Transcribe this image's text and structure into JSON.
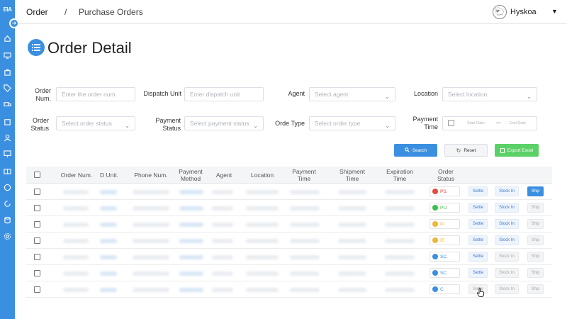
{
  "app": {
    "logo": "EIA"
  },
  "breadcrumb": {
    "section": "Order",
    "separator": "/",
    "page": "Purchase Orders"
  },
  "user": {
    "name": "Hyskoa"
  },
  "page": {
    "title": "Order Detail"
  },
  "filters": {
    "order_num": {
      "label": "Order Num.",
      "placeholder": "Enter the order num."
    },
    "dispatch_unit": {
      "label": "Dispatch Unit",
      "placeholder": "Enter dispatch unit"
    },
    "agent": {
      "label": "Agent",
      "placeholder": "Select agent"
    },
    "location": {
      "label": "Location",
      "placeholder": "Select location"
    },
    "order_status": {
      "label": "Order Status",
      "placeholder": "Select order status"
    },
    "payment_status": {
      "label": "Payment Status",
      "placeholder": "Select payment status"
    },
    "order_type": {
      "label": "Orde Type",
      "placeholder": "Select order type"
    },
    "payment_time": {
      "label": "Payment Time",
      "start_placeholder": "Start Date",
      "end_placeholder": "End Date",
      "range_separator": "<>"
    }
  },
  "actions": {
    "search": "Search",
    "reset": "Reset",
    "export": "Export Excel"
  },
  "table": {
    "headers": {
      "order_num": "Order Num.",
      "d_unit": "D Unit.",
      "phone": "Phone Num.",
      "payment_method": "Payment Method",
      "agent": "Agent",
      "location": "Location",
      "payment_time": "Payment Time",
      "shipment_time": "Shipment Time",
      "expiration_time": "Expiration Time",
      "order_status": "Order Status"
    },
    "row_actions": {
      "settle": "Settle",
      "stock_in": "Stock In",
      "ship": "Ship"
    },
    "rows": [
      {
        "status": "PS.",
        "status_icon": "stop-icon",
        "status_color": "#e8483f",
        "text_color": "#e8483f",
        "settle": true,
        "stock_in": true,
        "ship": true
      },
      {
        "status": "PU.",
        "status_icon": "check-circle-icon",
        "status_color": "#3bbf4a",
        "text_color": "#3bbf4a",
        "settle": true,
        "stock_in": true,
        "ship": false
      },
      {
        "status": "IP.",
        "status_icon": "dots-circle-icon",
        "status_color": "#f0b53a",
        "text_color": "#f0b53a",
        "settle": true,
        "stock_in": true,
        "ship": false
      },
      {
        "status": "IT.",
        "status_icon": "dots-circle-icon",
        "status_color": "#f0b53a",
        "text_color": "#f0b53a",
        "settle": true,
        "stock_in": true,
        "ship": false
      },
      {
        "status": "SC.",
        "status_icon": "check-circle-icon",
        "status_color": "#3b8fe0",
        "text_color": "#3b8fe0",
        "settle": true,
        "stock_in": false,
        "ship": false
      },
      {
        "status": "SC.",
        "status_icon": "check-circle-icon",
        "status_color": "#3b8fe0",
        "text_color": "#3b8fe0",
        "settle": true,
        "stock_in": false,
        "ship": false
      },
      {
        "status": "C",
        "status_icon": "check-circle-icon",
        "status_color": "#3b8fe0",
        "text_color": "#3b8fe0",
        "settle": false,
        "stock_in": false,
        "ship": false
      }
    ]
  },
  "sidebar": {
    "icons": [
      "home-icon",
      "monitor-icon",
      "bag-icon",
      "tag-icon",
      "truck-icon",
      "shopping-icon",
      "user-icon",
      "screen-icon",
      "gift-icon",
      "coin-icon",
      "refresh-icon",
      "database-icon",
      "settings-icon"
    ]
  }
}
